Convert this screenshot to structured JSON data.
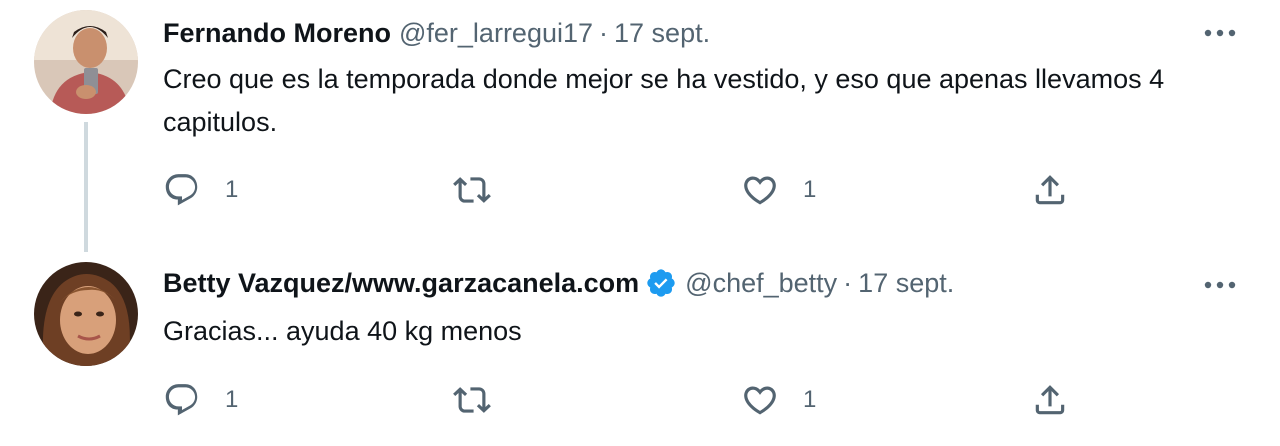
{
  "tweets": [
    {
      "name": "Fernando Moreno",
      "handle": "@fer_larregui17",
      "separator": "·",
      "date": "17 sept.",
      "verified": false,
      "text": "Creo que es la temporada donde mejor se ha vestido, y eso que apenas llevamos 4 capitulos.",
      "replies": "1",
      "retweets": "",
      "likes": "1"
    },
    {
      "name": "Betty Vazquez/www.garzacanela.com",
      "handle": "@chef_betty",
      "separator": "·",
      "date": "17 sept.",
      "verified": true,
      "text": "Gracias... ayuda 40 kg menos",
      "replies": "1",
      "retweets": "",
      "likes": "1"
    }
  ],
  "colors": {
    "text_primary": "#0f1419",
    "text_secondary": "#536471",
    "verified_blue": "#1d9bf0",
    "thread_line": "#cfd9de"
  },
  "icons": {
    "reply": "reply-icon",
    "retweet": "retweet-icon",
    "like": "heart-icon",
    "share": "share-icon",
    "more": "more-icon",
    "verified": "verified-badge-icon"
  }
}
